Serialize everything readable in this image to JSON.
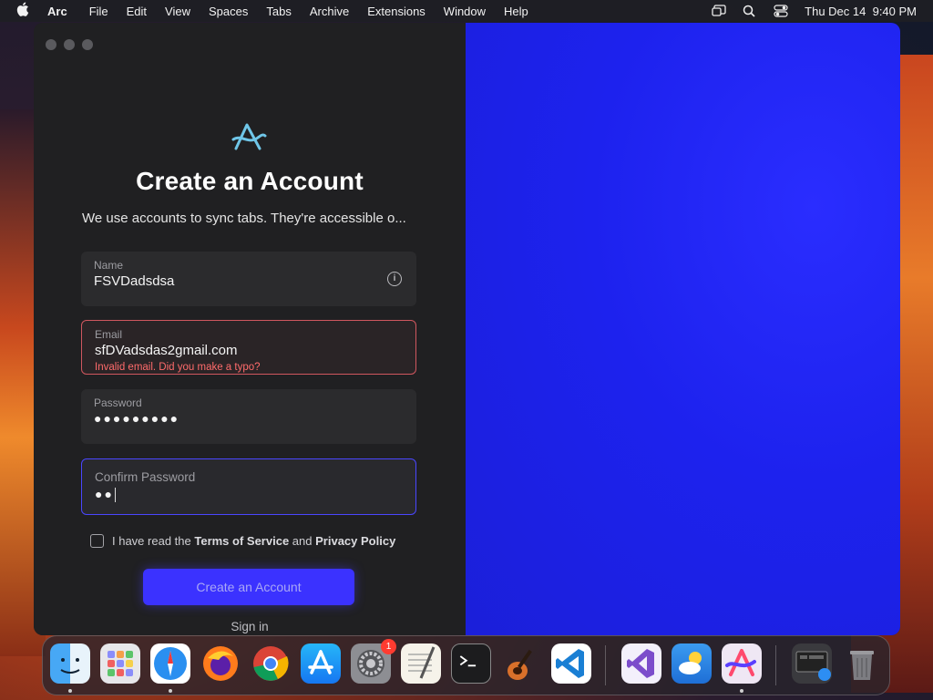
{
  "menubar": {
    "apple": "",
    "app_name": "Arc",
    "items": [
      "File",
      "Edit",
      "View",
      "Spaces",
      "Tabs",
      "Archive",
      "Extensions",
      "Window",
      "Help"
    ],
    "datetime": "Thu Dec 14  9:40 PM"
  },
  "signup": {
    "title": "Create an Account",
    "subtitle": "We use accounts to sync tabs. They're accessible o...",
    "name_label": "Name",
    "name_value": "FSVDadsdsa",
    "email_label": "Email",
    "email_value": "sfDVadsdas2gmail.com",
    "email_error": "Invalid email. Did you make a typo?",
    "password_label": "Password",
    "password_value": "●●●●●●●●●",
    "confirm_label": "Confirm Password",
    "confirm_value": "●●",
    "terms_prefix": "I have read the",
    "terms_link": "Terms of Service",
    "terms_and": "and",
    "privacy_link": "Privacy Policy",
    "create_button": "Create an Account",
    "sign_in": "Sign in"
  },
  "colors": {
    "accent": "#3b32ff",
    "error": "#ff6b6b",
    "right_pane": "#1d22ee"
  },
  "dock": {
    "apps": [
      "finder",
      "launchpad",
      "safari",
      "firefox",
      "chrome",
      "app-store",
      "system-settings",
      "textedit",
      "terminal",
      "garageband",
      "vscode",
      "visual-studio",
      "weather",
      "arc",
      "screenshot",
      "trash"
    ],
    "settings_badge": "1"
  }
}
